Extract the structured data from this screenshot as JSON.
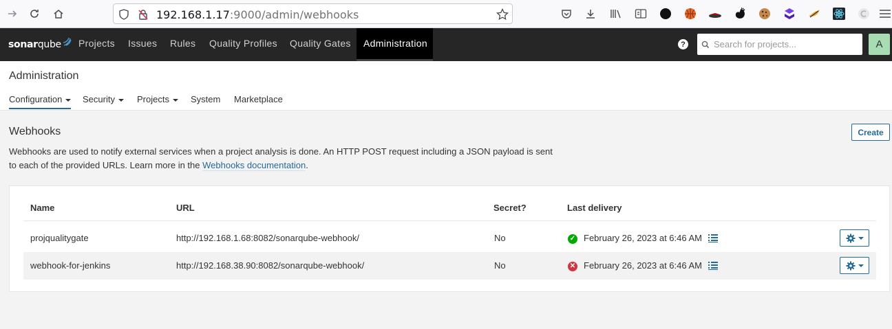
{
  "browser": {
    "url_host": "192.168.1.17",
    "url_path": ":9000/admin/webhooks"
  },
  "nav": {
    "logo_sonar": "sonar",
    "logo_qube": "qube",
    "items": [
      "Projects",
      "Issues",
      "Rules",
      "Quality Profiles",
      "Quality Gates",
      "Administration"
    ],
    "active": "Administration",
    "search_placeholder": "Search for projects...",
    "avatar_letter": "A",
    "help_glyph": "?"
  },
  "admin": {
    "title": "Administration",
    "tabs": [
      "Configuration",
      "Security",
      "Projects",
      "System",
      "Marketplace"
    ]
  },
  "webhooks": {
    "title": "Webhooks",
    "create_label": "Create",
    "description_part1": "Webhooks are used to notify external services when a project analysis is done. An HTTP POST request including a JSON payload is sent to each of the provided URLs. Learn more in the ",
    "doc_link": "Webhooks documentation",
    "description_end": ".",
    "columns": [
      "Name",
      "URL",
      "Secret?",
      "Last delivery"
    ],
    "rows": [
      {
        "name": "projqualitygate",
        "url": "http://192.168.1.68:8082/sonarqube-webhook/",
        "secret": "No",
        "last_delivery": "February 26, 2023 at 6:46 AM",
        "status": "success"
      },
      {
        "name": "webhook-for-jenkins",
        "url": "http://192.168.38.90:8082/sonarqube-webhook/",
        "secret": "No",
        "last_delivery": "February 26, 2023 at 6:46 AM",
        "status": "failure"
      }
    ]
  },
  "colors": {
    "nav_bg": "#262626",
    "link": "#236a97",
    "success": "#00aa00",
    "failure": "#d4333f",
    "avatar_bg": "#a8dcb2"
  }
}
